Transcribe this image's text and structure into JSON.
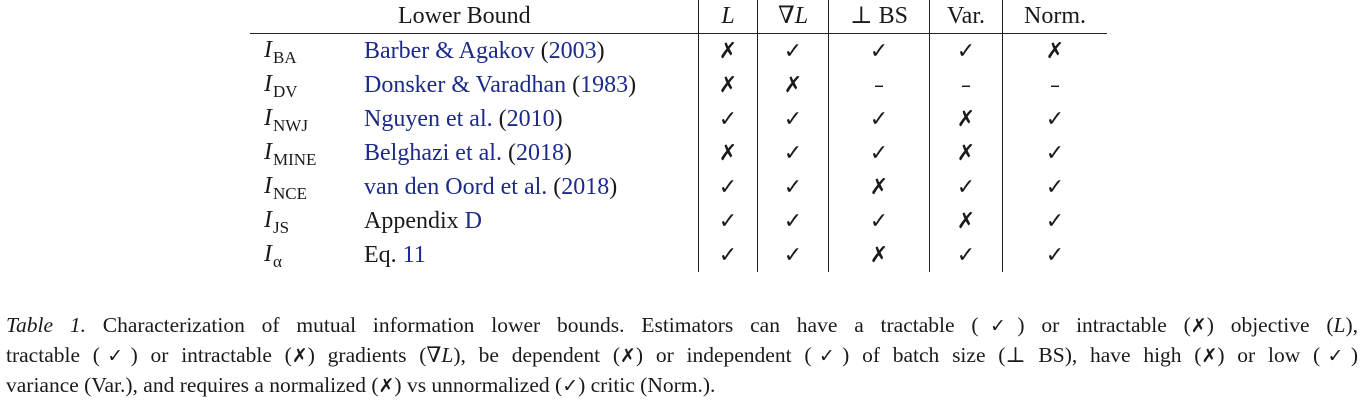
{
  "table": {
    "header": {
      "lower_bound": "Lower Bound",
      "L": "L",
      "grad_L": "∇L",
      "bs": "⊥ BS",
      "var": "Var.",
      "norm": "Norm."
    },
    "rows": [
      {
        "sym": "I",
        "sub": "BA",
        "ref_text": "Barber & Agakov",
        "ref_paren_open": " (",
        "ref_year": "2003",
        "ref_paren_close": ")",
        "cells": [
          "✗",
          "✓",
          "✓",
          "✓",
          "✗"
        ]
      },
      {
        "sym": "I",
        "sub": "DV",
        "ref_text": "Donsker & Varadhan",
        "ref_paren_open": " (",
        "ref_year": "1983",
        "ref_paren_close": ")",
        "cells": [
          "✗",
          "✗",
          "–",
          "–",
          "–"
        ]
      },
      {
        "sym": "I",
        "sub": "NWJ",
        "ref_text": "Nguyen et al.",
        "ref_paren_open": " (",
        "ref_year": "2010",
        "ref_paren_close": ")",
        "cells": [
          "✓",
          "✓",
          "✓",
          "✗",
          "✓"
        ]
      },
      {
        "sym": "I",
        "sub": "MINE",
        "ref_text": "Belghazi et al.",
        "ref_paren_open": " (",
        "ref_year": "2018",
        "ref_paren_close": ")",
        "cells": [
          "✗",
          "✓",
          "✓",
          "✗",
          "✓"
        ]
      },
      {
        "sym": "I",
        "sub": "NCE",
        "ref_text": "van den Oord et al.",
        "ref_paren_open": " (",
        "ref_year": "2018",
        "ref_paren_close": ")",
        "cells": [
          "✓",
          "✓",
          "✗",
          "✓",
          "✓"
        ]
      },
      {
        "sym": "I",
        "sub": "JS",
        "ref_plain": "Appendix ",
        "ref_link": "D",
        "cells": [
          "✓",
          "✓",
          "✓",
          "✗",
          "✓"
        ]
      },
      {
        "sym": "I",
        "sub": "α",
        "ref_plain": "Eq. ",
        "ref_link": "11",
        "cells": [
          "✓",
          "✓",
          "✗",
          "✓",
          "✓"
        ]
      }
    ]
  },
  "caption": {
    "label": "Table 1.",
    "line1": " Characterization of mutual information lower bounds. Estimators can have a tractable (✓) or intractable (✗) objective (L),",
    "line2": "tractable (✓) or intractable (✗) gradients (∇L), be dependent (✗) or independent (✓) of batch size (⊥ BS), have high (✗) or low (✓)",
    "line3": "variance (Var.), and requires a normalized (✗) vs unnormalized (✓) critic (Norm.)."
  }
}
